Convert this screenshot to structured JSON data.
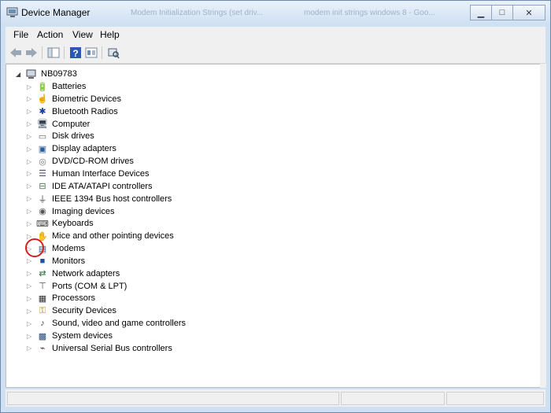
{
  "window": {
    "title": "Device Manager",
    "background_tabs": [
      "Modem Initialization Strings (set driv...",
      "modem init strings windows 8 - Goo..."
    ]
  },
  "menu": [
    "File",
    "Action",
    "View",
    "Help"
  ],
  "tree": {
    "root": "NB09783",
    "items": [
      {
        "label": "Batteries",
        "icon": "battery-icon"
      },
      {
        "label": "Biometric Devices",
        "icon": "biometric-icon"
      },
      {
        "label": "Bluetooth Radios",
        "icon": "bluetooth-icon"
      },
      {
        "label": "Computer",
        "icon": "computer-icon"
      },
      {
        "label": "Disk drives",
        "icon": "disk-drive-icon"
      },
      {
        "label": "Display adapters",
        "icon": "display-adapter-icon"
      },
      {
        "label": "DVD/CD-ROM drives",
        "icon": "dvd-drive-icon"
      },
      {
        "label": "Human Interface Devices",
        "icon": "hid-icon"
      },
      {
        "label": "IDE ATA/ATAPI controllers",
        "icon": "ide-controller-icon"
      },
      {
        "label": "IEEE 1394 Bus host controllers",
        "icon": "ieee1394-icon"
      },
      {
        "label": "Imaging devices",
        "icon": "camera-icon"
      },
      {
        "label": "Keyboards",
        "icon": "keyboard-icon"
      },
      {
        "label": "Mice and other pointing devices",
        "icon": "mouse-icon"
      },
      {
        "label": "Modems",
        "icon": "modem-icon"
      },
      {
        "label": "Monitors",
        "icon": "monitor-icon"
      },
      {
        "label": "Network adapters",
        "icon": "network-adapter-icon"
      },
      {
        "label": "Ports (COM & LPT)",
        "icon": "port-icon"
      },
      {
        "label": "Processors",
        "icon": "processor-icon"
      },
      {
        "label": "Security Devices",
        "icon": "security-key-icon"
      },
      {
        "label": "Sound, video and game controllers",
        "icon": "speaker-icon"
      },
      {
        "label": "System devices",
        "icon": "system-device-icon"
      },
      {
        "label": "Universal Serial Bus controllers",
        "icon": "usb-icon"
      }
    ]
  },
  "highlight": {
    "item": "Modems",
    "color": "#d42020"
  }
}
